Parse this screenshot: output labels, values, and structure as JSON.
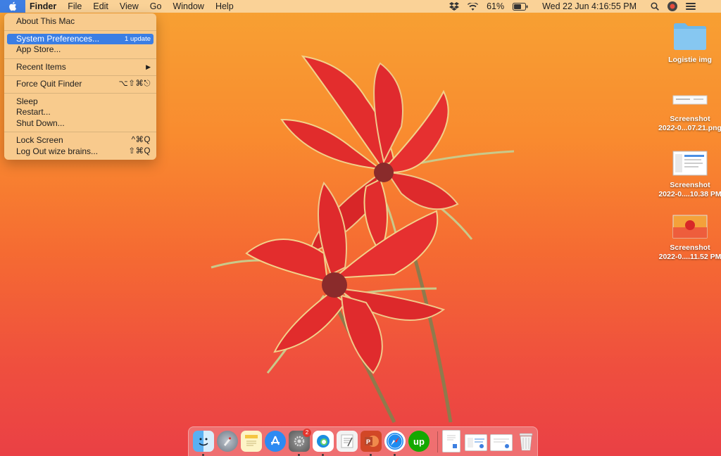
{
  "menubar": {
    "app_name": "Finder",
    "menus": [
      "File",
      "Edit",
      "View",
      "Go",
      "Window",
      "Help"
    ],
    "battery": "61%",
    "datetime": "Wed 22 Jun  4:16:55 PM"
  },
  "apple_menu": {
    "items": {
      "about": "About This Mac",
      "system_prefs": "System Preferences...",
      "system_prefs_badge": "1 update",
      "app_store": "App Store...",
      "recent_items": "Recent Items",
      "force_quit": "Force Quit Finder",
      "force_quit_shortcut": "⌥⇧⌘⎋",
      "sleep": "Sleep",
      "restart": "Restart...",
      "shutdown": "Shut Down...",
      "lock_screen": "Lock Screen",
      "lock_screen_shortcut": "^⌘Q",
      "log_out": "Log Out wize brains...",
      "log_out_shortcut": "⇧⌘Q"
    }
  },
  "desktop": {
    "icons": [
      {
        "name": "Logistie img"
      },
      {
        "name_line1": "Screenshot",
        "name_line2": "2022-0...07.21.png"
      },
      {
        "name_line1": "Screenshot",
        "name_line2": "2022-0....10.38 PM"
      },
      {
        "name_line1": "Screenshot",
        "name_line2": "2022-0....11.52 PM"
      }
    ]
  },
  "dock": {
    "apps": [
      "finder-icon",
      "launchpad-icon",
      "notes-icon",
      "app-store-icon",
      "system-preferences-icon",
      "edge-icon",
      "textedit-icon",
      "powerpoint-icon",
      "safari-icon",
      "upwork-icon"
    ],
    "system_prefs_badge": "2",
    "upwork_label": "up"
  },
  "colors": {
    "menu_highlight": "#3b7ee4",
    "wallpaper_top": "#f7a233",
    "wallpaper_bottom": "#ea4045"
  }
}
